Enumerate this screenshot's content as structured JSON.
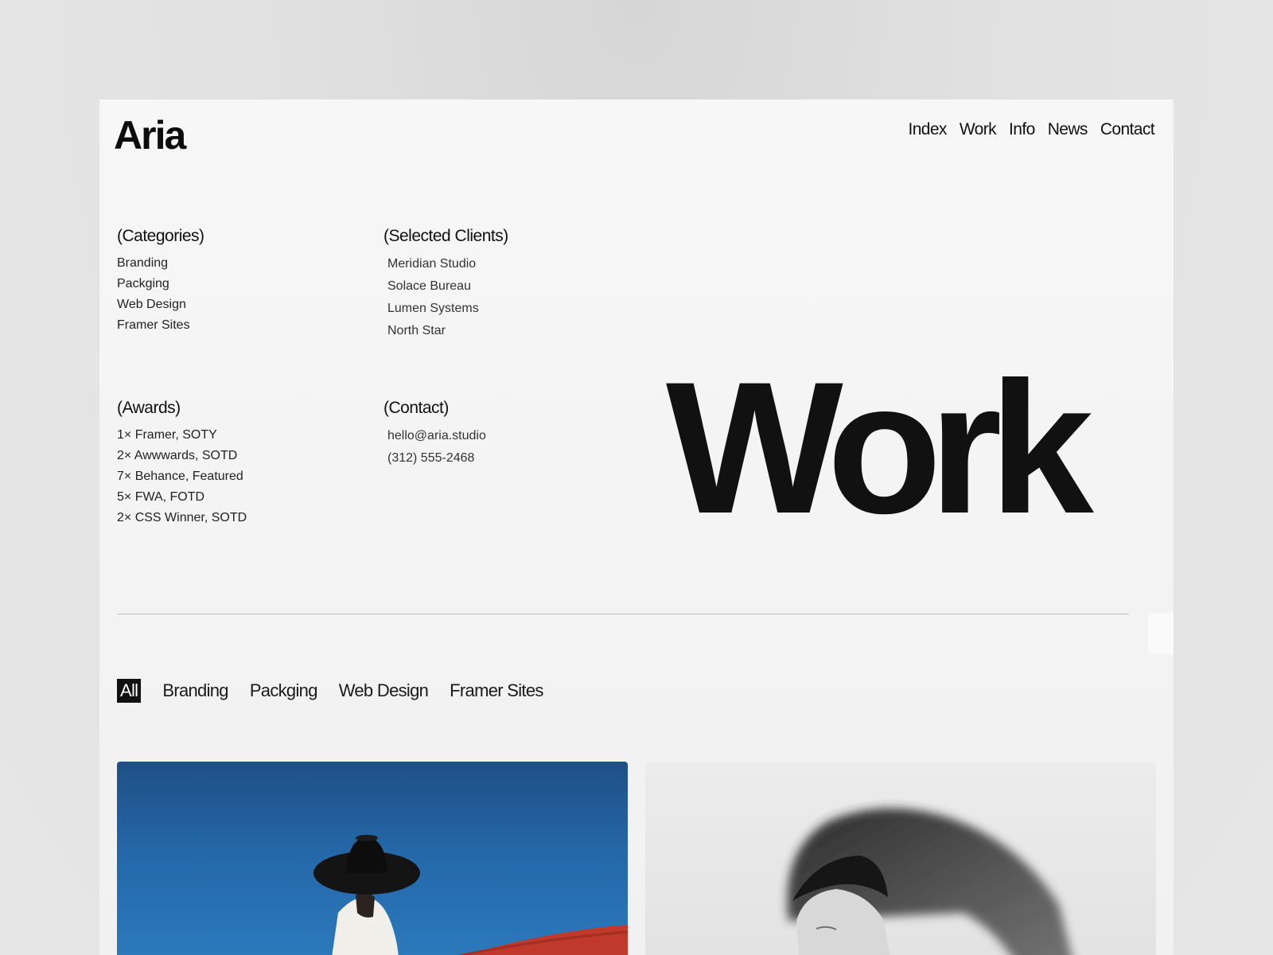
{
  "brand": {
    "logo": "Aria"
  },
  "nav": [
    "Index",
    "Work",
    "Info",
    "News",
    "Contact"
  ],
  "categories": {
    "heading": "(Categories)",
    "items": [
      "Branding",
      "Packging",
      "Web Design",
      "Framer Sites"
    ]
  },
  "clients": {
    "heading": "(Selected Clients)",
    "items": [
      "Meridian Studio",
      "Solace Bureau",
      "Lumen Systems",
      "North Star"
    ]
  },
  "awards": {
    "heading": "(Awards)",
    "items": [
      "1× Framer, SOTY",
      "2× Awwwards, SOTD",
      "7× Behance, Featured",
      "5× FWA, FOTD",
      "2× CSS Winner, SOTD"
    ]
  },
  "contact": {
    "heading": "(Contact)",
    "email": "hello@aria.studio",
    "phone": "(312) 555-2468"
  },
  "hero": {
    "title": "Work"
  },
  "filters": {
    "active": "All",
    "items": [
      "All",
      "Branding",
      "Packging",
      "Web Design",
      "Framer Sites"
    ]
  },
  "colors": {
    "text": "#111111",
    "active_filter_bg": "#111111",
    "card_one_sky": "#2468a9",
    "card_one_ground": "#c0392b"
  }
}
